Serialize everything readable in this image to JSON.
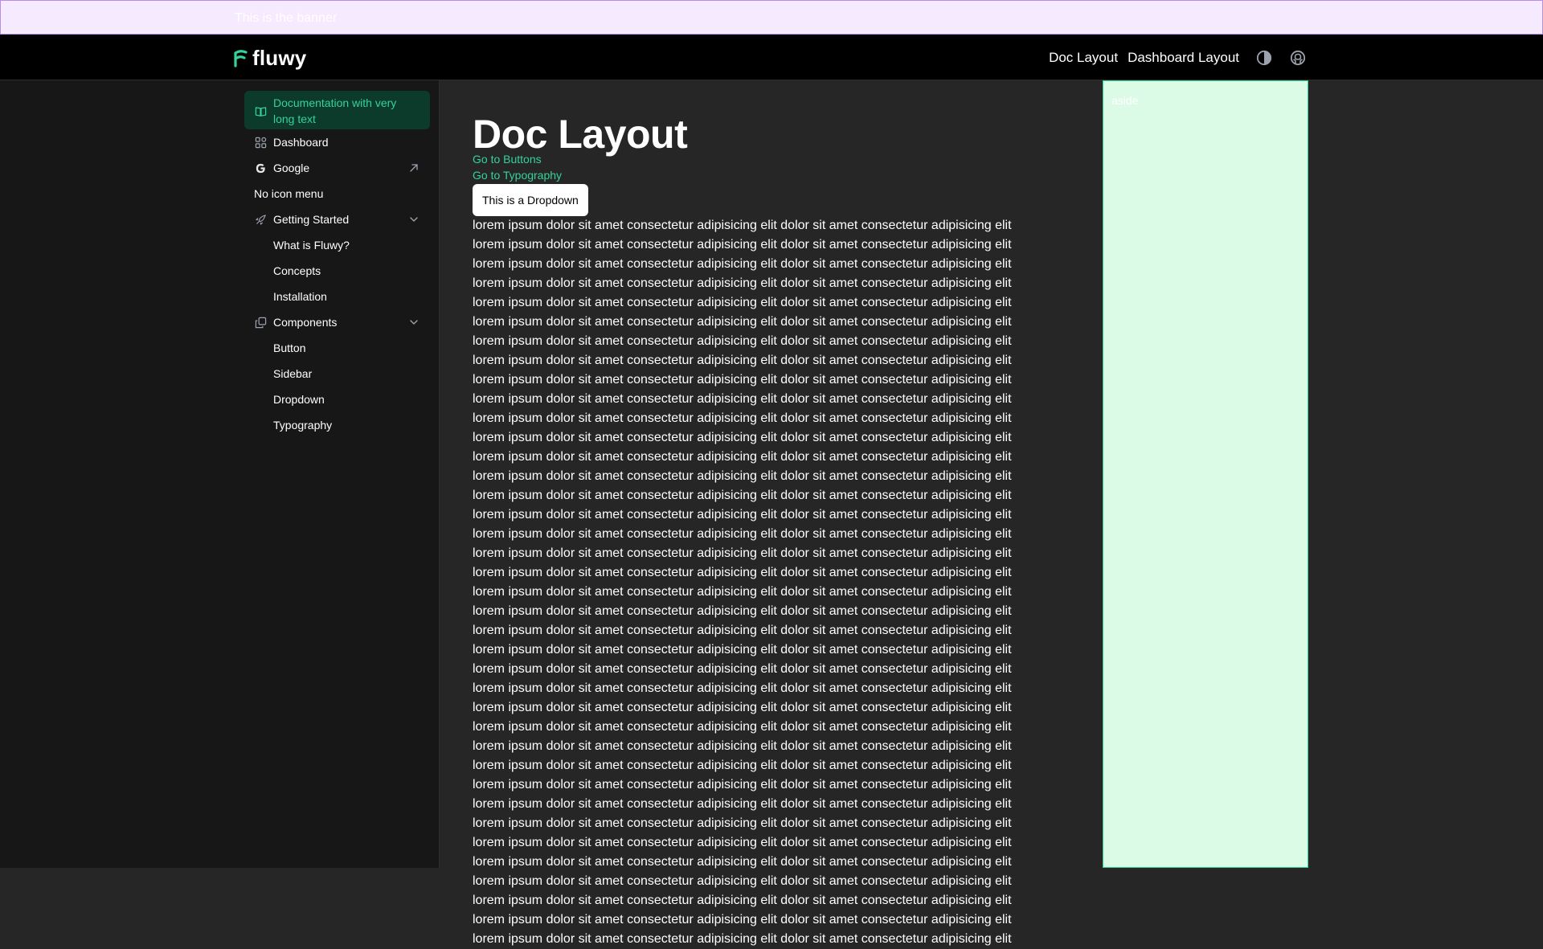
{
  "banner": {
    "text": "This is the banner"
  },
  "header": {
    "brand": "fluwy",
    "nav": [
      {
        "label": "Doc Layout"
      },
      {
        "label": "Dashboard Layout"
      }
    ],
    "icons": [
      "theme-toggle-icon",
      "github-icon"
    ]
  },
  "sidebar": {
    "items": [
      {
        "label": "Documentation with very long text",
        "icon": "book-icon",
        "active": true
      },
      {
        "label": "Dashboard",
        "icon": "dashboard-icon"
      },
      {
        "label": "Google",
        "icon": "google-icon",
        "trailing": "external-link-icon"
      },
      {
        "label": "No icon menu"
      },
      {
        "label": "Getting Started",
        "icon": "rocket-icon",
        "trailing": "chevron-down-icon",
        "children": [
          {
            "label": "What is Fluwy?"
          },
          {
            "label": "Concepts"
          },
          {
            "label": "Installation"
          }
        ]
      },
      {
        "label": "Components",
        "icon": "components-icon",
        "trailing": "chevron-down-icon",
        "children": [
          {
            "label": "Button"
          },
          {
            "label": "Sidebar"
          },
          {
            "label": "Dropdown"
          },
          {
            "label": "Typography"
          }
        ]
      }
    ]
  },
  "main": {
    "title": "Doc Layout",
    "links": [
      {
        "label": "Go to Buttons"
      },
      {
        "label": "Go to Typography"
      }
    ],
    "dropdown_label": "This is a Dropdown",
    "paragraphs": [
      "lorem ipsum dolor sit amet consectetur adipisicing elit dolor sit amet consectetur adipisicing elit",
      "lorem ipsum dolor sit amet consectetur adipisicing elit dolor sit amet consectetur adipisicing elit",
      "lorem ipsum dolor sit amet consectetur adipisicing elit dolor sit amet consectetur adipisicing elit",
      "lorem ipsum dolor sit amet consectetur adipisicing elit dolor sit amet consectetur adipisicing elit",
      "lorem ipsum dolor sit amet consectetur adipisicing elit dolor sit amet consectetur adipisicing elit",
      "lorem ipsum dolor sit amet consectetur adipisicing elit dolor sit amet consectetur adipisicing elit",
      "lorem ipsum dolor sit amet consectetur adipisicing elit dolor sit amet consectetur adipisicing elit",
      "lorem ipsum dolor sit amet consectetur adipisicing elit dolor sit amet consectetur adipisicing elit",
      "lorem ipsum dolor sit amet consectetur adipisicing elit dolor sit amet consectetur adipisicing elit",
      "lorem ipsum dolor sit amet consectetur adipisicing elit dolor sit amet consectetur adipisicing elit",
      "lorem ipsum dolor sit amet consectetur adipisicing elit dolor sit amet consectetur adipisicing elit",
      "lorem ipsum dolor sit amet consectetur adipisicing elit dolor sit amet consectetur adipisicing elit",
      "lorem ipsum dolor sit amet consectetur adipisicing elit dolor sit amet consectetur adipisicing elit",
      "lorem ipsum dolor sit amet consectetur adipisicing elit dolor sit amet consectetur adipisicing elit",
      "lorem ipsum dolor sit amet consectetur adipisicing elit dolor sit amet consectetur adipisicing elit",
      "lorem ipsum dolor sit amet consectetur adipisicing elit dolor sit amet consectetur adipisicing elit",
      "lorem ipsum dolor sit amet consectetur adipisicing elit dolor sit amet consectetur adipisicing elit",
      "lorem ipsum dolor sit amet consectetur adipisicing elit dolor sit amet consectetur adipisicing elit",
      "lorem ipsum dolor sit amet consectetur adipisicing elit dolor sit amet consectetur adipisicing elit",
      "lorem ipsum dolor sit amet consectetur adipisicing elit dolor sit amet consectetur adipisicing elit",
      "lorem ipsum dolor sit amet consectetur adipisicing elit dolor sit amet consectetur adipisicing elit",
      "lorem ipsum dolor sit amet consectetur adipisicing elit dolor sit amet consectetur adipisicing elit",
      "lorem ipsum dolor sit amet consectetur adipisicing elit dolor sit amet consectetur adipisicing elit",
      "lorem ipsum dolor sit amet consectetur adipisicing elit dolor sit amet consectetur adipisicing elit",
      "lorem ipsum dolor sit amet consectetur adipisicing elit dolor sit amet consectetur adipisicing elit",
      "lorem ipsum dolor sit amet consectetur adipisicing elit dolor sit amet consectetur adipisicing elit",
      "lorem ipsum dolor sit amet consectetur adipisicing elit dolor sit amet consectetur adipisicing elit",
      "lorem ipsum dolor sit amet consectetur adipisicing elit dolor sit amet consectetur adipisicing elit",
      "lorem ipsum dolor sit amet consectetur adipisicing elit dolor sit amet consectetur adipisicing elit",
      "lorem ipsum dolor sit amet consectetur adipisicing elit dolor sit amet consectetur adipisicing elit",
      "lorem ipsum dolor sit amet consectetur adipisicing elit dolor sit amet consectetur adipisicing elit",
      "lorem ipsum dolor sit amet consectetur adipisicing elit dolor sit amet consectetur adipisicing elit",
      "lorem ipsum dolor sit amet consectetur adipisicing elit dolor sit amet consectetur adipisicing elit",
      "lorem ipsum dolor sit amet consectetur adipisicing elit dolor sit amet consectetur adipisicing elit",
      "lorem ipsum dolor sit amet consectetur adipisicing elit dolor sit amet consectetur adipisicing elit",
      "lorem ipsum dolor sit amet consectetur adipisicing elit dolor sit amet consectetur adipisicing elit",
      "lorem ipsum dolor sit amet consectetur adipisicing elit dolor sit amet consectetur adipisicing elit",
      "lorem ipsum dolor sit amet consectetur adipisicing elit dolor sit amet consectetur adipisicing elit"
    ]
  },
  "aside": {
    "text": "aside"
  },
  "colors": {
    "accent": "#34d399",
    "banner_bg": "#f6eafe",
    "banner_border": "#b88cef",
    "aside_bg": "#dbfbe7",
    "header_bg": "#000000",
    "sidebar_bg": "#171717",
    "content_bg": "#262626"
  }
}
